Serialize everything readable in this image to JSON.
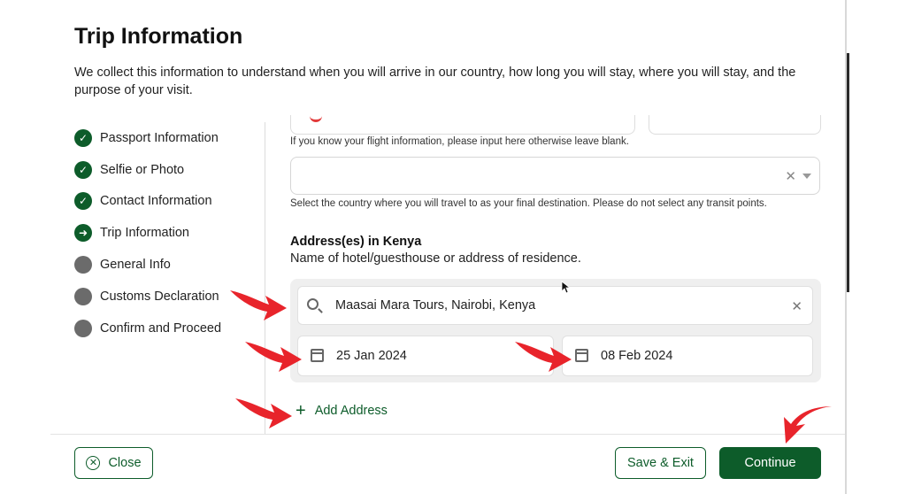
{
  "modal": {
    "title": "Trip Information",
    "description": "We collect this information to understand when you will arrive in our country, how long you will stay, where you will stay, and the purpose of your visit."
  },
  "steps": [
    {
      "label": "Passport Information",
      "status": "done"
    },
    {
      "label": "Selfie or Photo",
      "status": "done"
    },
    {
      "label": "Contact Information",
      "status": "done"
    },
    {
      "label": "Trip Information",
      "status": "current"
    },
    {
      "label": "General Info",
      "status": "todo"
    },
    {
      "label": "Customs Declaration",
      "status": "todo"
    },
    {
      "label": "Confirm and Proceed",
      "status": "todo"
    }
  ],
  "form": {
    "flight_hint": "If you know your flight information, please input here otherwise leave blank.",
    "destination_hint": "Select the country where you will travel to as your final destination. Please do not select any transit points.",
    "address_title": "Address(es) in Kenya",
    "address_subtitle": "Name of hotel/guesthouse or address of residence.",
    "address_value": "Maasai Mara Tours, Nairobi, Kenya",
    "start_date": "25 Jan 2024",
    "end_date": "08 Feb 2024",
    "add_address_label": "Add Address"
  },
  "footer": {
    "close_label": "Close",
    "save_exit_label": "Save & Exit",
    "continue_label": "Continue"
  },
  "colors": {
    "primary": "#0d5c2a",
    "pending": "#6b6b6b",
    "annotation_arrow": "#e8242b"
  }
}
